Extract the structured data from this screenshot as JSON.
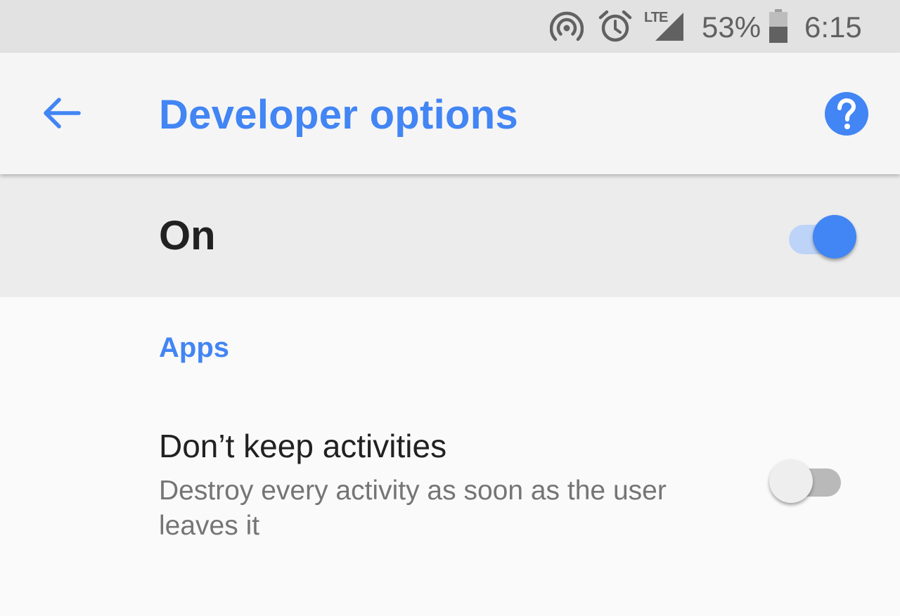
{
  "status_bar": {
    "network_label": "LTE",
    "battery_percent": "53%",
    "battery_level": 0.53,
    "time": "6:15",
    "icons": [
      "hotspot-icon",
      "alarm-icon",
      "lte-signal-icon",
      "battery-icon"
    ]
  },
  "app_bar": {
    "title": "Developer options",
    "back_icon": "arrow-back-icon",
    "help_icon": "help-icon"
  },
  "master_switch": {
    "label": "On",
    "checked": true
  },
  "sections": [
    {
      "header": "Apps",
      "items": [
        {
          "title": "Don’t keep activities",
          "summary": "Destroy every activity as soon as the user leaves it",
          "checked": false
        }
      ]
    }
  ],
  "colors": {
    "accent": "#4285f4",
    "accent_track": "#bdd3f7",
    "status_bar_bg": "#e2e2e2",
    "app_bar_bg": "#f5f5f5",
    "master_row_bg": "#ececec",
    "page_bg": "#fafafa",
    "primary_text": "#212121",
    "secondary_text": "#757575"
  }
}
